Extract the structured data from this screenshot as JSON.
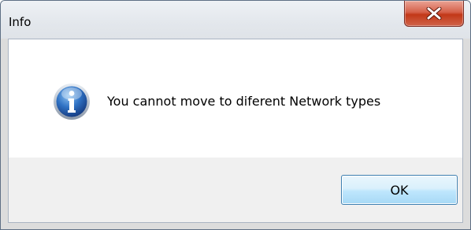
{
  "window": {
    "title": "Info"
  },
  "dialog": {
    "icon": "info-icon",
    "message": "You cannot move to diferent Network types",
    "ok_label": "OK"
  },
  "colors": {
    "close_button": "#c23818",
    "ok_border": "#3c7fb1",
    "info_icon_blue": "#1f5ea8"
  }
}
